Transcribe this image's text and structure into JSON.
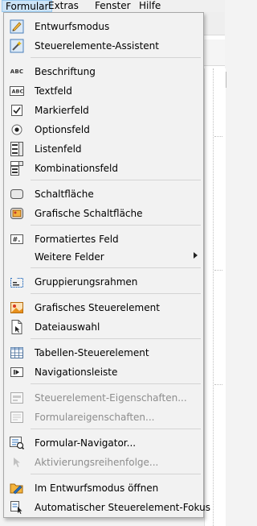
{
  "menubar": {
    "items": [
      {
        "label": "Formular"
      },
      {
        "label": "Extras"
      },
      {
        "label": "Fenster"
      },
      {
        "label": "Hilfe"
      }
    ]
  },
  "menu": {
    "items": [
      {
        "label": "Entwurfsmodus",
        "icon": "design-mode-icon",
        "enabled": true
      },
      {
        "label": "Steuerelemente-Assistent",
        "icon": "control-wizard-icon",
        "enabled": true
      },
      {
        "label": "Beschriftung",
        "icon": "label-abc-icon",
        "enabled": true
      },
      {
        "label": "Textfeld",
        "icon": "textbox-icon",
        "enabled": true
      },
      {
        "label": "Markierfeld",
        "icon": "checkbox-icon",
        "enabled": true
      },
      {
        "label": "Optionsfeld",
        "icon": "radio-button-icon",
        "enabled": true
      },
      {
        "label": "Listenfeld",
        "icon": "listbox-icon",
        "enabled": true
      },
      {
        "label": "Kombinationsfeld",
        "icon": "combobox-icon",
        "enabled": true
      },
      {
        "label": "Schaltfläche",
        "icon": "push-button-icon",
        "enabled": true
      },
      {
        "label": "Grafische Schaltfläche",
        "icon": "image-button-icon",
        "enabled": true
      },
      {
        "label": "Formatiertes Feld",
        "icon": "formatted-field-icon",
        "enabled": true
      },
      {
        "label": "Weitere Felder",
        "icon": "",
        "enabled": true,
        "submenu": true
      },
      {
        "label": "Gruppierungsrahmen",
        "icon": "group-box-icon",
        "enabled": true
      },
      {
        "label": "Grafisches Steuerelement",
        "icon": "image-control-icon",
        "enabled": true
      },
      {
        "label": "Dateiauswahl",
        "icon": "file-selection-icon",
        "enabled": true
      },
      {
        "label": "Tabellen-Steuerelement",
        "icon": "table-control-icon",
        "enabled": true
      },
      {
        "label": "Navigationsleiste",
        "icon": "navigation-bar-icon",
        "enabled": true
      },
      {
        "label": "Steuerelement-Eigenschaften...",
        "icon": "control-properties-icon",
        "enabled": false
      },
      {
        "label": "Formulareigenschaften...",
        "icon": "form-properties-icon",
        "enabled": false
      },
      {
        "label": "Formular-Navigator...",
        "icon": "form-navigator-icon",
        "enabled": true
      },
      {
        "label": "Aktivierungsreihenfolge...",
        "icon": "activation-order-icon",
        "enabled": false
      },
      {
        "label": "Im Entwurfsmodus öffnen",
        "icon": "open-in-design-mode-icon",
        "enabled": true
      },
      {
        "label": "Automatischer Steuerelement-Fokus",
        "icon": "auto-control-focus-icon",
        "enabled": true
      }
    ]
  },
  "colors": {
    "menu_bg": "#f2f2f2",
    "active_menubar_bg": "#cce4f7",
    "disabled_text": "#8d8d8d",
    "icon_blue": "#2a6fbd",
    "icon_orange": "#e8901c"
  }
}
